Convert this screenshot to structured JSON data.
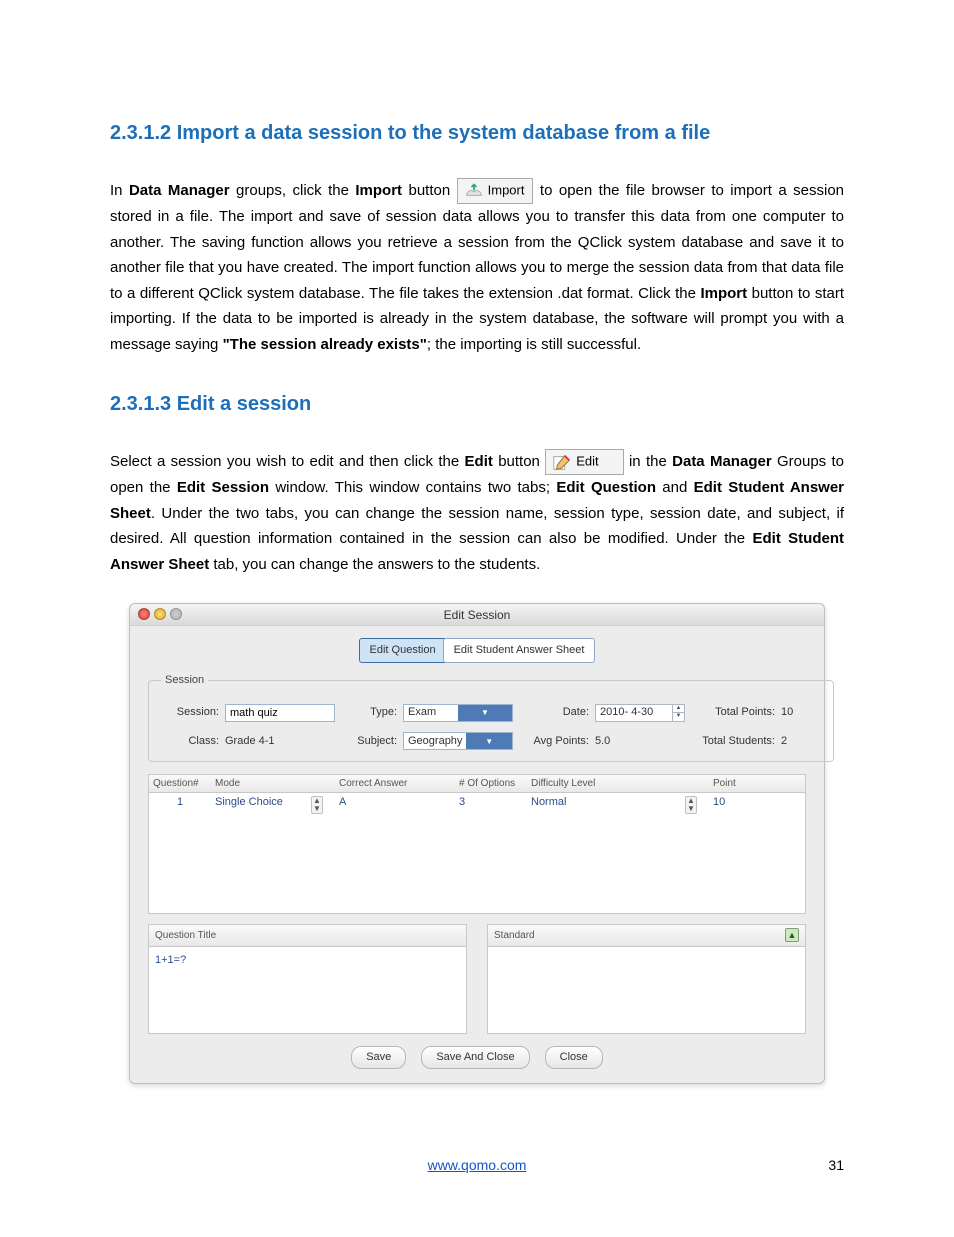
{
  "section1": {
    "heading": "2.3.1.2 Import a data session to the system database from a file",
    "p1a": "In ",
    "p1_strong1": "Data Manager",
    "p1b": " groups, click the ",
    "p1_strong2": "Import",
    "p1c": " button ",
    "import_btn_label": "Import",
    "p1d": " to open the file browser to import a session stored in a file. The import and save of session data allows you to transfer this data from one computer to another. The saving function allows you retrieve a session from the QClick system database and save it to another file that you have created. The import function allows you to merge the session data from that data file to a different QClick system database. The file takes the extension .dat format. Click the ",
    "p1_strong3": "Import",
    "p1e": " button to start importing. If the data to be imported is already in the system database, the software will prompt you with a message saying ",
    "p1_strong4": "\"The session already exists\"",
    "p1f": "; the importing is still successful."
  },
  "section2": {
    "heading": "2.3.1.3 Edit a session",
    "p1a": "Select a session you wish to edit and then click the ",
    "p1_strong1": "Edit",
    "p1b": " button",
    "edit_btn_label": "Edit",
    "p1c": " in the ",
    "p1_strong2": "Data Manager",
    "p1d": " Groups to open the ",
    "p1_strong3": "Edit Session",
    "p1e": " window. This window contains two tabs; ",
    "p1_strong4": "Edit Question",
    "p1f": " and ",
    "p1_strong5": "Edit Student Answer Sheet",
    "p1g": ". Under the two tabs, you can change the session name, session type, session date, and subject, if desired. All question information contained in the session can also be modified. Under the ",
    "p1_strong6": "Edit Student Answer Sheet",
    "p1h": " tab, you can change the answers to the students."
  },
  "window": {
    "title": "Edit Session",
    "tabs": {
      "active": "Edit Question",
      "inactive": "Edit Student Answer Sheet"
    },
    "fieldset_legend": "Session",
    "labels": {
      "session": "Session:",
      "type": "Type:",
      "date": "Date:",
      "total_points": "Total Points:",
      "class_": "Class:",
      "subject": "Subject:",
      "avg_points": "Avg Points:",
      "total_students": "Total Students:"
    },
    "values": {
      "session": "math quiz",
      "type": "Exam",
      "date": "2010- 4-30",
      "total_points": "10",
      "class_": "Grade 4-1",
      "subject": "Geography",
      "avg_points": "5.0",
      "total_students": "2"
    },
    "table_headers": {
      "qnum": "Question#",
      "mode": "Mode",
      "answer": "Correct Answer",
      "options": "# Of Options",
      "difficulty": "Difficulty Level",
      "point": "Point"
    },
    "row": {
      "qnum": "1",
      "mode": "Single Choice",
      "answer": "A",
      "options": "3",
      "difficulty": "Normal",
      "point": "10"
    },
    "lower": {
      "title_label": "Question Title",
      "title_value": "1+1=?",
      "standard_label": "Standard"
    },
    "buttons": {
      "save": "Save",
      "save_close": "Save And Close",
      "close": "Close"
    }
  },
  "footer": {
    "url": "www.qomo.com",
    "page": "31"
  }
}
